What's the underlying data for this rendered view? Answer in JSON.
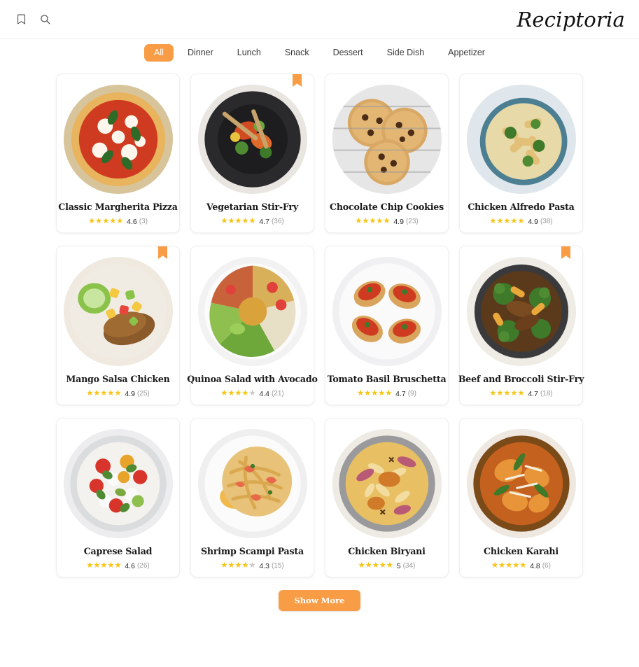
{
  "header": {
    "brand": "Reciptoria",
    "bookmark_icon": "bookmark-icon",
    "search_icon": "search-icon"
  },
  "categories": [
    {
      "label": "All",
      "active": true
    },
    {
      "label": "Dinner",
      "active": false
    },
    {
      "label": "Lunch",
      "active": false
    },
    {
      "label": "Snack",
      "active": false
    },
    {
      "label": "Dessert",
      "active": false
    },
    {
      "label": "Side Dish",
      "active": false
    },
    {
      "label": "Appetizer",
      "active": false
    }
  ],
  "recipes": [
    {
      "title": "Classic Margherita Pizza",
      "rating": "4.6",
      "count": "(3)",
      "stars_full": 5,
      "bookmarked": false,
      "image": "margherita-pizza"
    },
    {
      "title": "Vegetarian Stir-Fry",
      "rating": "4.7",
      "count": "(36)",
      "stars_full": 5,
      "bookmarked": true,
      "image": "vegetarian-stir-fry"
    },
    {
      "title": "Chocolate Chip Cookies",
      "rating": "4.9",
      "count": "(23)",
      "stars_full": 5,
      "bookmarked": false,
      "image": "chocolate-chip-cookies"
    },
    {
      "title": "Chicken Alfredo Pasta",
      "rating": "4.9",
      "count": "(38)",
      "stars_full": 5,
      "bookmarked": false,
      "image": "chicken-alfredo-pasta"
    },
    {
      "title": "Mango Salsa Chicken",
      "rating": "4.9",
      "count": "(25)",
      "stars_full": 5,
      "bookmarked": true,
      "image": "mango-salsa-chicken"
    },
    {
      "title": "Quinoa Salad with Avocado",
      "rating": "4.4",
      "count": "(21)",
      "stars_full": 4,
      "bookmarked": false,
      "image": "quinoa-salad-avocado"
    },
    {
      "title": "Tomato Basil Bruschetta",
      "rating": "4.7",
      "count": "(9)",
      "stars_full": 5,
      "bookmarked": false,
      "image": "tomato-basil-bruschetta"
    },
    {
      "title": "Beef and Broccoli Stir-Fry",
      "rating": "4.7",
      "count": "(18)",
      "stars_full": 5,
      "bookmarked": true,
      "image": "beef-broccoli-stir-fry"
    },
    {
      "title": "Caprese Salad",
      "rating": "4.6",
      "count": "(26)",
      "stars_full": 5,
      "bookmarked": false,
      "image": "caprese-salad"
    },
    {
      "title": "Shrimp Scampi Pasta",
      "rating": "4.3",
      "count": "(15)",
      "stars_full": 4,
      "bookmarked": false,
      "image": "shrimp-scampi-pasta"
    },
    {
      "title": "Chicken Biryani",
      "rating": "5",
      "count": "(34)",
      "stars_full": 5,
      "bookmarked": false,
      "image": "chicken-biryani"
    },
    {
      "title": "Chicken Karahi",
      "rating": "4.8",
      "count": "(6)",
      "stars_full": 5,
      "bookmarked": false,
      "image": "chicken-karahi"
    }
  ],
  "footer": {
    "show_more_label": "Show More"
  },
  "colors": {
    "accent": "#F89C46",
    "star": "#F5C518",
    "star_off": "#c9c9c9"
  }
}
